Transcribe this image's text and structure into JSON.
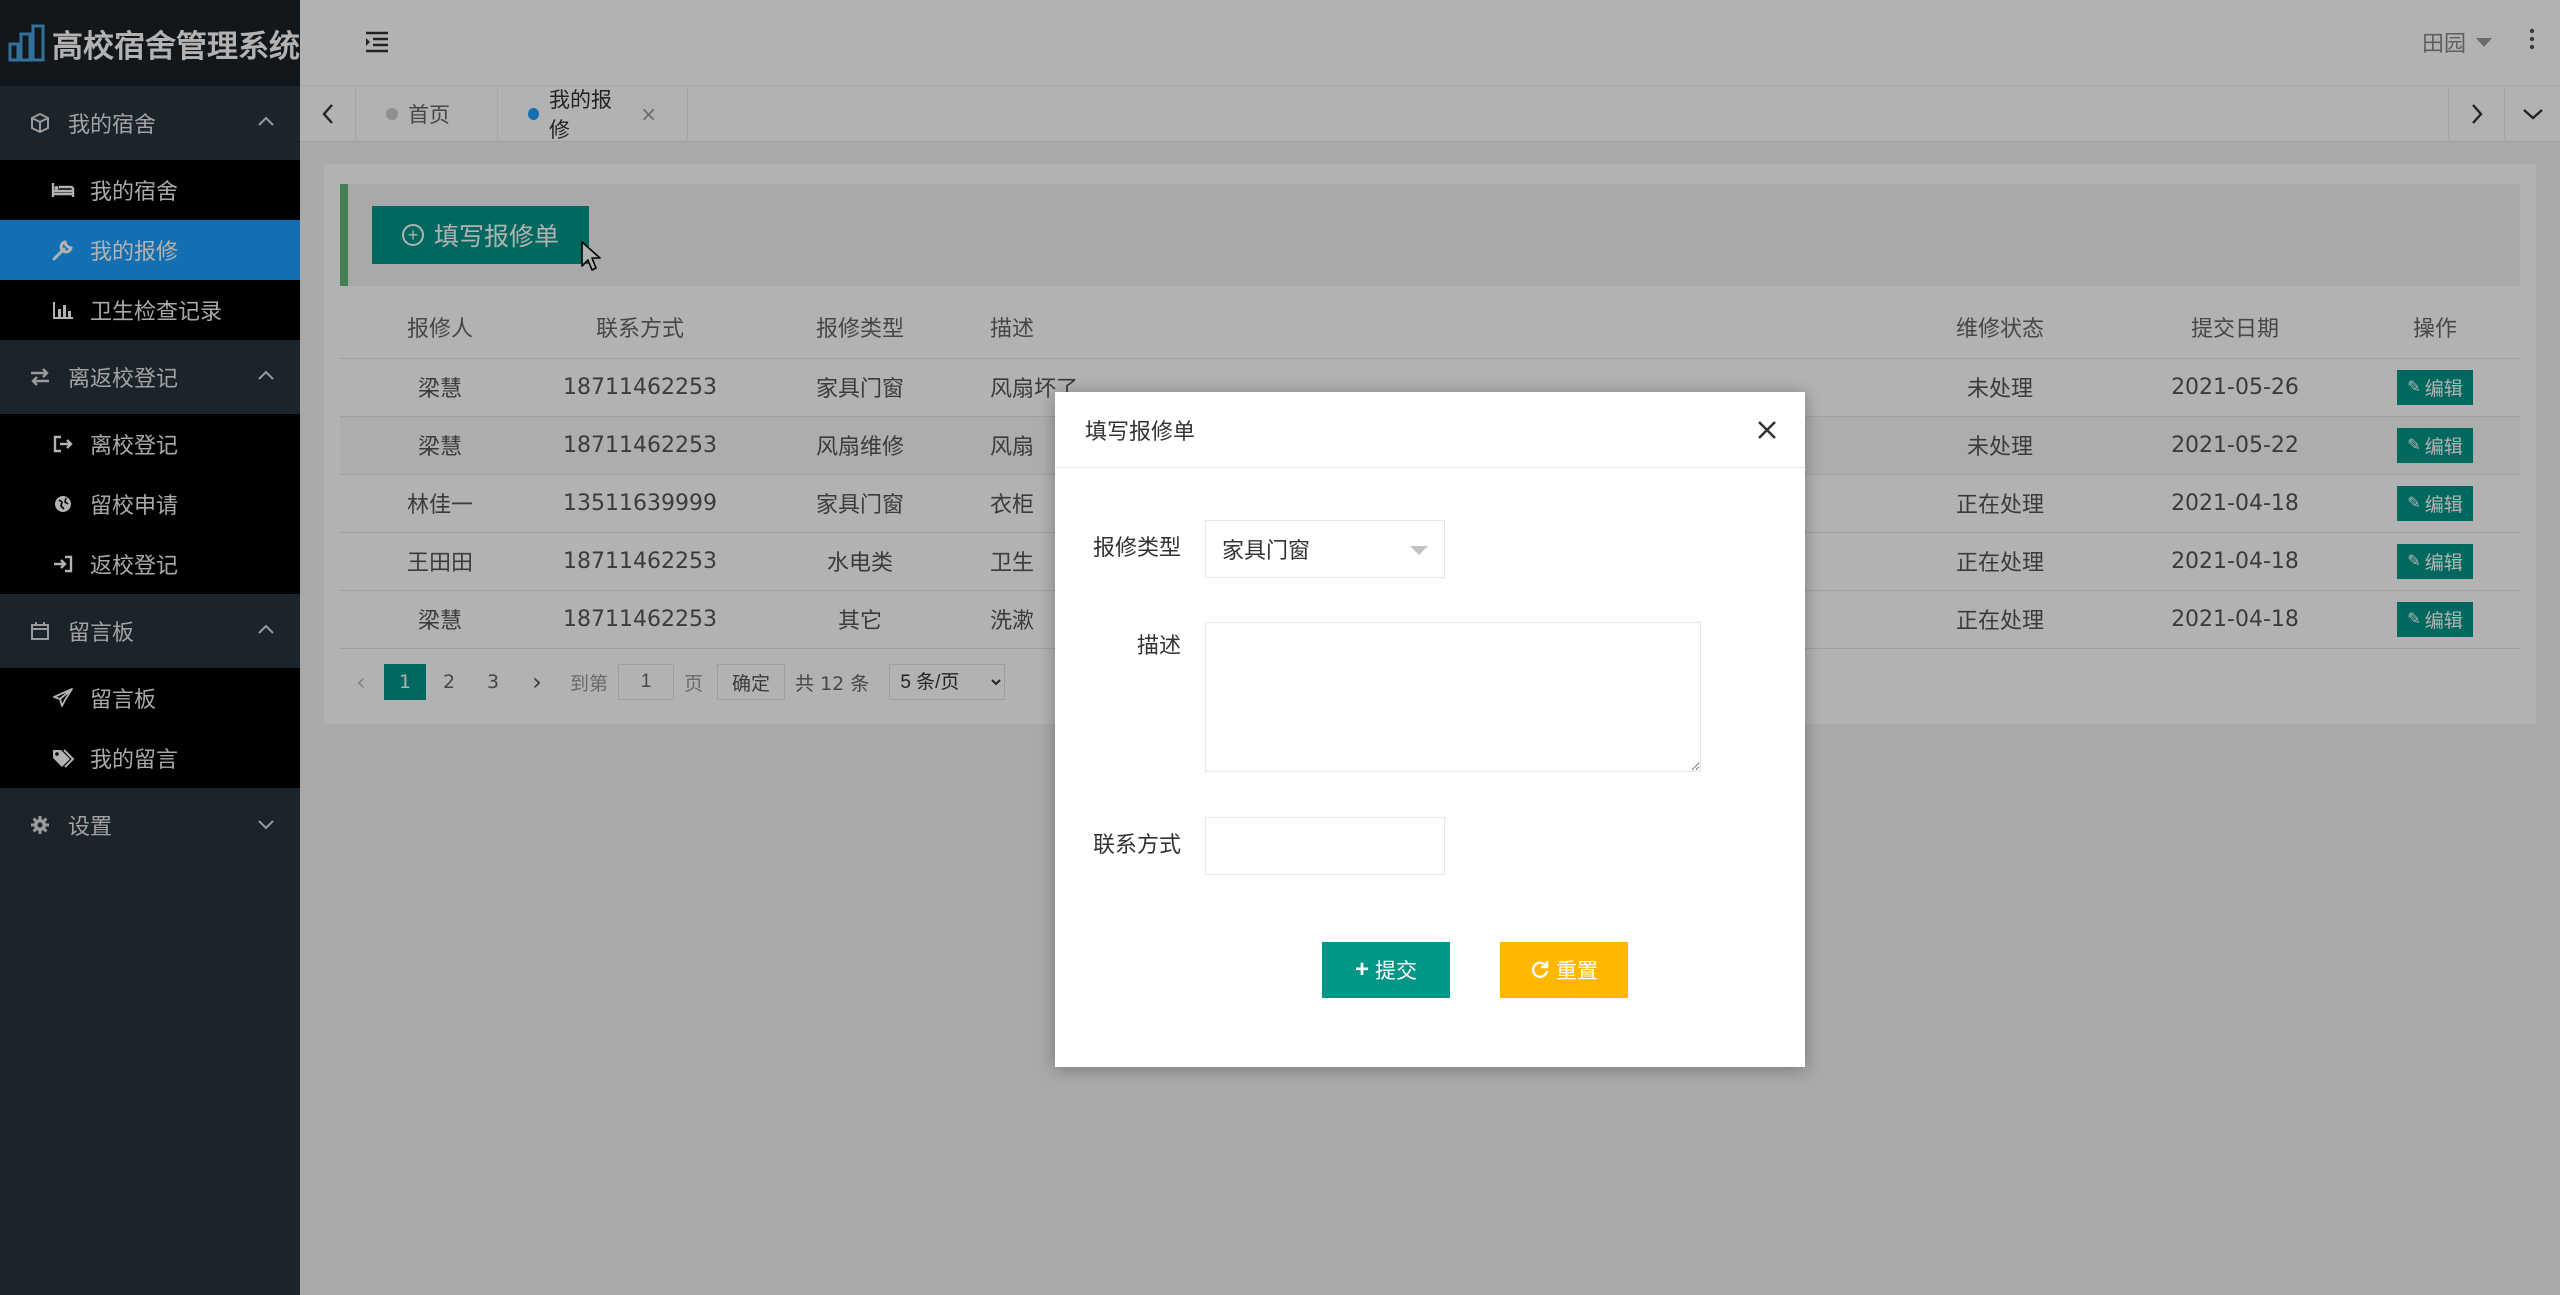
{
  "app": {
    "title": "高校宿舍管理系统"
  },
  "sidebar": {
    "groups": [
      {
        "label": "我的宿舍",
        "icon": "cube-icon",
        "expanded": true,
        "items": [
          {
            "label": "我的宿舍",
            "icon": "bed-icon"
          },
          {
            "label": "我的报修",
            "icon": "wrench-icon",
            "active": true
          },
          {
            "label": "卫生检查记录",
            "icon": "bar-chart-icon"
          }
        ]
      },
      {
        "label": "离返校登记",
        "icon": "exchange-icon",
        "expanded": true,
        "items": [
          {
            "label": "离校登记",
            "icon": "sign-out-icon"
          },
          {
            "label": "留校申请",
            "icon": "globe-icon"
          },
          {
            "label": "返校登记",
            "icon": "sign-in-icon"
          }
        ]
      },
      {
        "label": "留言板",
        "icon": "calendar-icon",
        "expanded": true,
        "items": [
          {
            "label": "留言板",
            "icon": "paper-plane-icon"
          },
          {
            "label": "我的留言",
            "icon": "tags-icon"
          }
        ]
      },
      {
        "label": "设置",
        "icon": "gear-icon",
        "expanded": false,
        "items": []
      }
    ]
  },
  "header": {
    "user": "田园"
  },
  "tabs": [
    {
      "label": "首页",
      "active": false
    },
    {
      "label": "我的报修",
      "active": true,
      "close": "×"
    }
  ],
  "toolbar": {
    "add_label": "填写报修单"
  },
  "table": {
    "columns": [
      "报修人",
      "联系方式",
      "报修类型",
      "描述",
      "维修状态",
      "提交日期",
      "操作"
    ],
    "rows": [
      {
        "name": "梁慧",
        "phone": "18711462253",
        "type": "家具门窗",
        "desc": "风扇坏了",
        "status": "未处理",
        "date": "2021-05-26",
        "action": "编辑"
      },
      {
        "name": "梁慧",
        "phone": "18711462253",
        "type": "风扇维修",
        "desc": "风扇",
        "status": "未处理",
        "date": "2021-05-22",
        "action": "编辑"
      },
      {
        "name": "林佳一",
        "phone": "13511639999",
        "type": "家具门窗",
        "desc": "衣柜",
        "status": "正在处理",
        "date": "2021-04-18",
        "action": "编辑"
      },
      {
        "name": "王田田",
        "phone": "18711462253",
        "type": "水电类",
        "desc": "卫生",
        "status": "正在处理",
        "date": "2021-04-18",
        "action": "编辑"
      },
      {
        "name": "梁慧",
        "phone": "18711462253",
        "type": "其它",
        "desc": "洗漱",
        "status": "正在处理",
        "date": "2021-04-18",
        "action": "编辑"
      }
    ]
  },
  "pager": {
    "pages": [
      "1",
      "2",
      "3"
    ],
    "current": "1",
    "goto_label": "到第",
    "goto_value": "1",
    "page_unit": "页",
    "confirm": "确定",
    "total": "共 12 条",
    "page_size": "5 条/页"
  },
  "modal": {
    "title": "填写报修单",
    "type_label": "报修类型",
    "type_value": "家具门窗",
    "desc_label": "描述",
    "desc_value": "",
    "contact_label": "联系方式",
    "contact_value": "",
    "submit_label": "提交",
    "reset_label": "重置"
  },
  "colors": {
    "primary": "#009688",
    "accent": "#1e9fff",
    "warm": "#ffb800",
    "sidebar": "#28333e",
    "toolbar_border": "#5fb878"
  }
}
